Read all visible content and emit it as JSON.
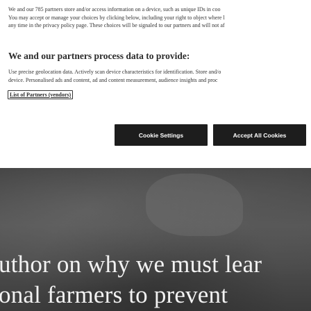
{
  "consent": {
    "intro_lines": [
      "We and our 785 partners store and/or access information on a device, such as unique IDs in coo",
      "You may accept or manage your choices by clicking below, including your right to object where l",
      "any time in the privacy policy page. These choices will be signaled to our partners and will not af"
    ],
    "process_heading": "We and our partners process data to provide:",
    "process_desc_lines": [
      "Use precise geolocation data. Actively scan device characteristics for identification. Store and/o",
      "device. Personalised ads and content, ad and content measurement, audience insights and proc"
    ],
    "partners_link": "List of Partners (vendors)",
    "cookie_settings_label": "Cookie Settings",
    "accept_all_label": "Accept All Cookies"
  },
  "background": {
    "headline_lines": [
      "uthor on why we must lear",
      "onal farmers to prevent"
    ]
  },
  "colors": {
    "button_bg": "#1d1d1d",
    "button_text": "#ffffff",
    "backdrop_text": "#f2f2f2"
  }
}
